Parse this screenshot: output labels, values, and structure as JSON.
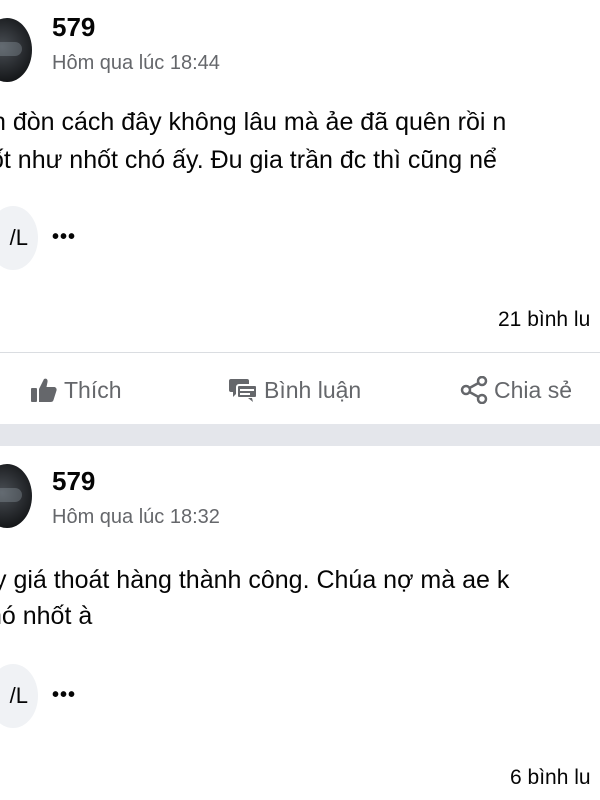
{
  "posts": [
    {
      "author": "579",
      "timestamp": "Hôm qua lúc 18:44",
      "lines": [
        "n đòn cách đây không lâu mà ảe đã quên rồi n",
        "ốt như nhốt chó ấy. Đu gia trần đc thì cũng nể"
      ],
      "reaction_label": "/L",
      "more": "•••",
      "comment_count": "21 bình lu"
    },
    {
      "author": "579",
      "timestamp": "Hôm qua lúc 18:32",
      "lines": [
        "y giá thoát hàng thành công. Chúa nợ mà ae k",
        "nó nhốt à"
      ],
      "reaction_label": "/L",
      "more": "•••",
      "comment_count": "6 bình lu"
    }
  ],
  "actions": {
    "like_label": "Thích",
    "comment_label": "Bình luận",
    "share_label": "Chia sẻ"
  },
  "icons": {
    "like": "thumbs-up-icon",
    "comment": "comment-bubble-icon",
    "share": "share-icon",
    "more": "more-dots-icon"
  },
  "colors": {
    "text": "#050505",
    "secondary": "#65676b",
    "separator": "#e4e6eb",
    "chip": "#f0f2f5"
  }
}
